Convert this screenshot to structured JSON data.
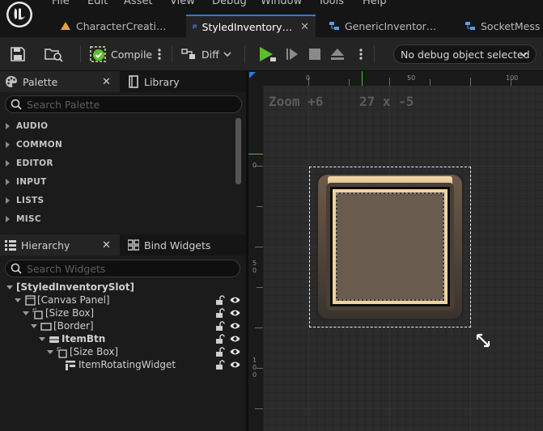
{
  "menu": [
    "File",
    "Edit",
    "Asset",
    "View",
    "Debug",
    "Window",
    "Tools",
    "Help"
  ],
  "tabs": [
    {
      "label": "CharacterCreati…",
      "icon": "blueprint-warning-icon"
    },
    {
      "label": "StyledInventory…",
      "icon": "widget-blueprint-icon",
      "close": "✕"
    },
    {
      "label": "GenericInventor…",
      "icon": "class-icon"
    },
    {
      "label": "SocketMess",
      "icon": "class-icon"
    }
  ],
  "toolbar": {
    "compile_label": "Compile",
    "diff_label": "Diff",
    "debug_object": "No debug object selected"
  },
  "palette": {
    "tab_label": "Palette",
    "library_label": "Library",
    "search_placeholder": "Search Palette",
    "categories": [
      "AUDIO",
      "COMMON",
      "EDITOR",
      "INPUT",
      "LISTS",
      "MISC"
    ]
  },
  "hierarchy": {
    "tab_label": "Hierarchy",
    "bind_label": "Bind Widgets",
    "search_placeholder": "Search Widgets",
    "items": [
      {
        "label": "[StyledInventorySlot]",
        "depth": 0,
        "bold": true,
        "icon": "none"
      },
      {
        "label": "[Canvas Panel]",
        "depth": 1,
        "bold": false,
        "icon": "canvas-panel-icon"
      },
      {
        "label": "[Size Box]",
        "depth": 2,
        "bold": false,
        "icon": "size-box-icon"
      },
      {
        "label": "[Border]",
        "depth": 3,
        "bold": false,
        "icon": "border-icon"
      },
      {
        "label": "ItemBtn",
        "depth": 4,
        "bold": true,
        "icon": "button-icon"
      },
      {
        "label": "[Size Box]",
        "depth": 5,
        "bold": false,
        "icon": "size-box-icon"
      },
      {
        "label": "ItemRotatingWidget",
        "depth": 6,
        "bold": false,
        "icon": "user-widget-icon"
      }
    ]
  },
  "viewport": {
    "zoom": "Zoom +6",
    "dims": "27 x -5",
    "ruler_top": [
      "0",
      "50",
      "100"
    ],
    "ruler_left": [
      "0",
      "5\n0",
      "1\n0\n0"
    ]
  },
  "colors": {
    "accent": "#2979e5",
    "play": "#5cbf2a",
    "slot_frame": "#5a4a3e",
    "slot_highlight": "#f0cfa0",
    "slot_inner": "#6c5d4f"
  }
}
